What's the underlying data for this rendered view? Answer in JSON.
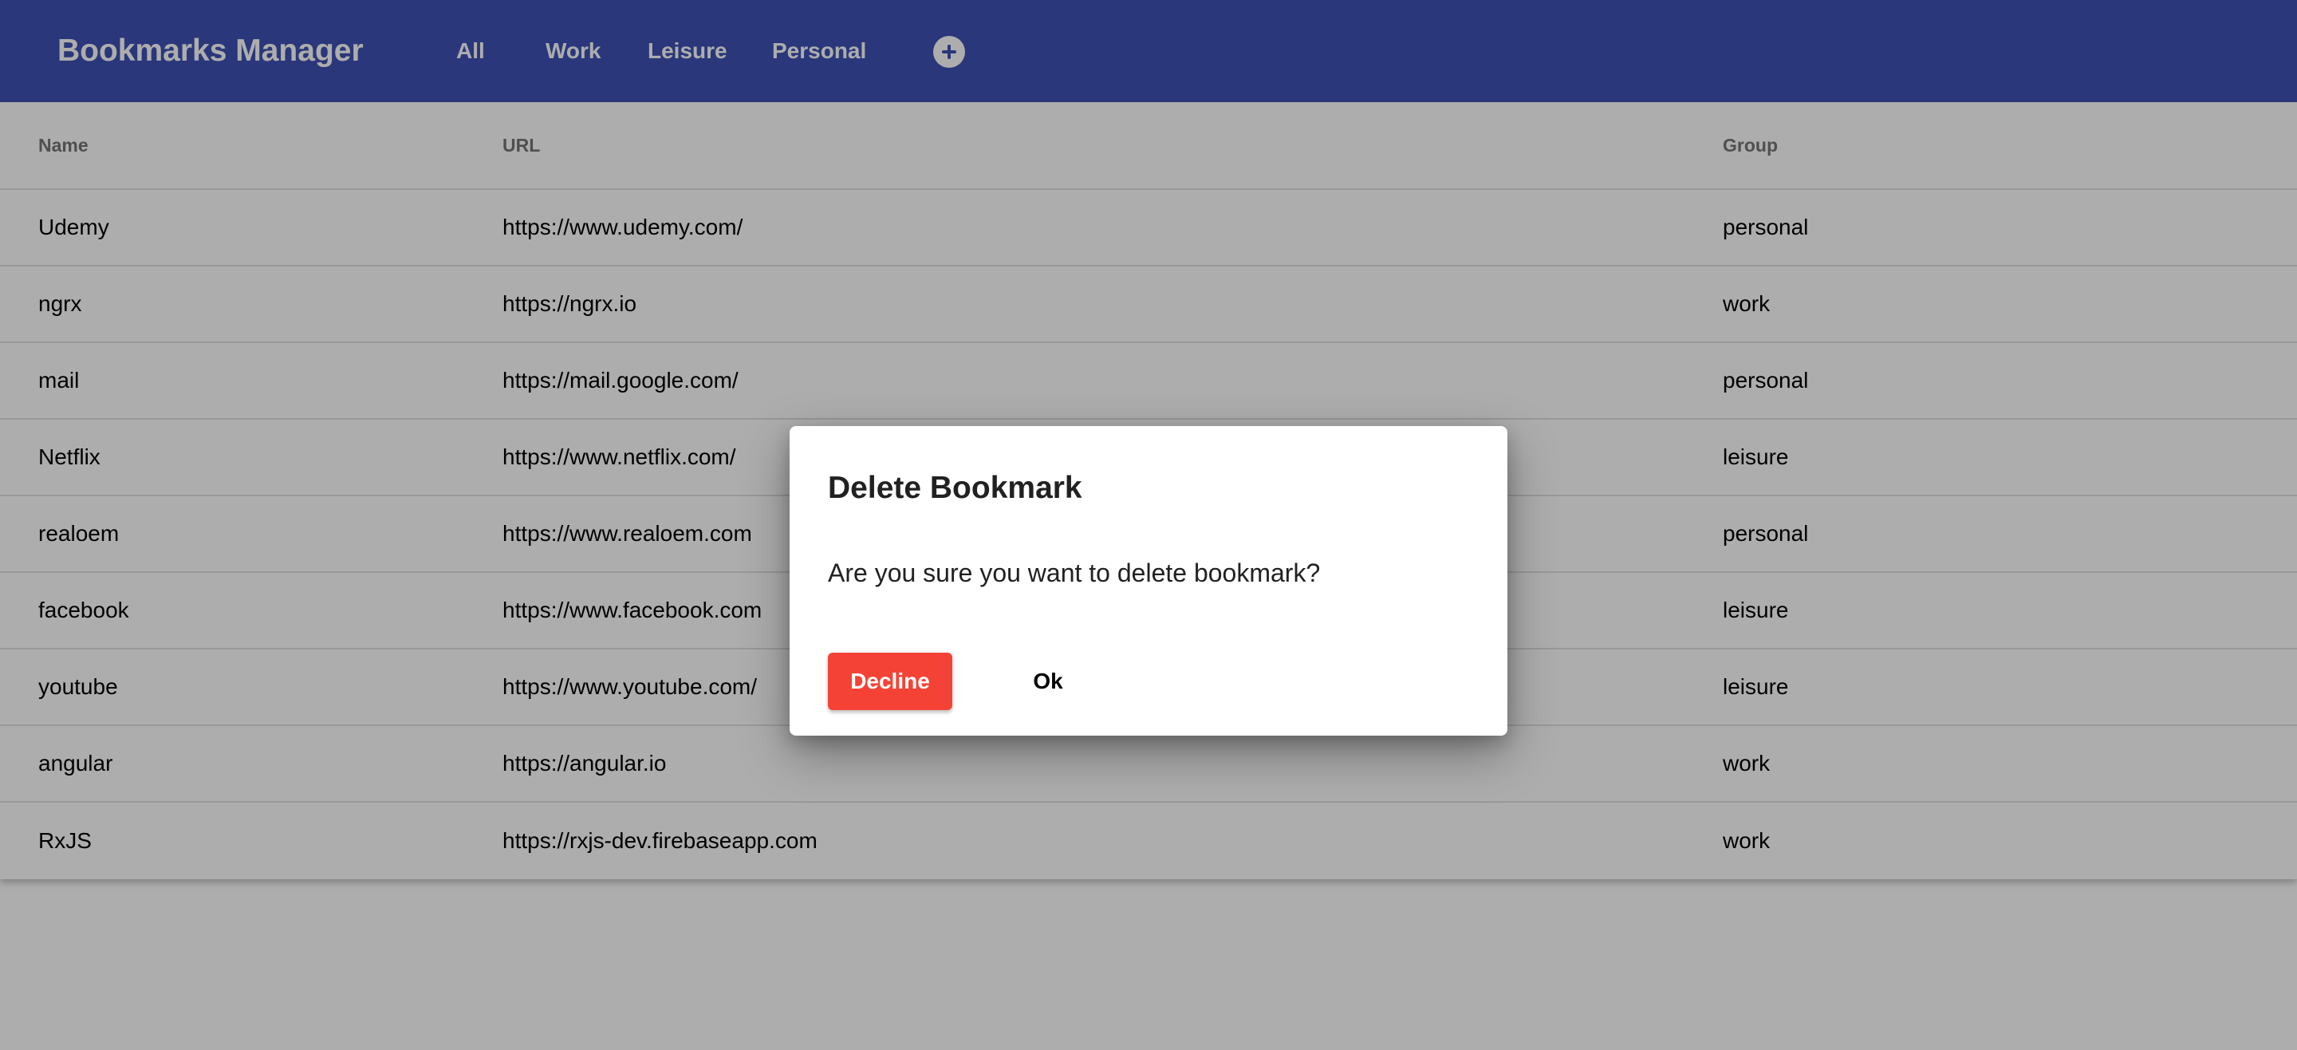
{
  "app": {
    "title": "Bookmarks Manager"
  },
  "nav": {
    "all": "All",
    "work": "Work",
    "leisure": "Leisure",
    "personal": "Personal",
    "add_icon": "plus-circle-icon"
  },
  "table": {
    "headers": {
      "name": "Name",
      "url": "URL",
      "group": "Group"
    },
    "rows": [
      {
        "name": "Udemy",
        "url": "https://www.udemy.com/",
        "group": "personal"
      },
      {
        "name": "ngrx",
        "url": "https://ngrx.io",
        "group": "work"
      },
      {
        "name": "mail",
        "url": "https://mail.google.com/",
        "group": "personal"
      },
      {
        "name": "Netflix",
        "url": "https://www.netflix.com/",
        "group": "leisure"
      },
      {
        "name": "realoem",
        "url": "https://www.realoem.com",
        "group": "personal"
      },
      {
        "name": "facebook",
        "url": "https://www.facebook.com",
        "group": "leisure"
      },
      {
        "name": "youtube",
        "url": "https://www.youtube.com/",
        "group": "leisure"
      },
      {
        "name": "angular",
        "url": "https://angular.io",
        "group": "work"
      },
      {
        "name": "RxJS",
        "url": "https://rxjs-dev.firebaseapp.com",
        "group": "work"
      }
    ]
  },
  "dialog": {
    "title": "Delete Bookmark",
    "message": "Are you sure you want to delete bookmark?",
    "decline_label": "Decline",
    "ok_label": "Ok"
  },
  "colors": {
    "primary": "#3f51b5",
    "warn": "#f44336"
  }
}
